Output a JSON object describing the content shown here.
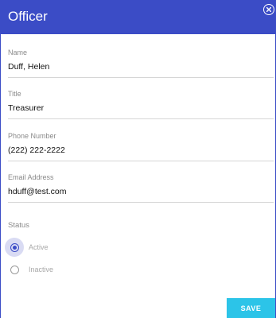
{
  "dialog": {
    "title": "Officer"
  },
  "fields": {
    "name": {
      "label": "Name",
      "value": "Duff, Helen"
    },
    "title": {
      "label": "Title",
      "value": "Treasurer"
    },
    "phone": {
      "label": "Phone Number",
      "value": "(222) 222-2222"
    },
    "email": {
      "label": "Email Address",
      "value": "hduff@test.com"
    }
  },
  "status": {
    "label": "Status",
    "options": [
      {
        "label": "Active",
        "checked": true
      },
      {
        "label": "Inactive",
        "checked": false
      }
    ]
  },
  "actions": {
    "save_label": "SAVE"
  },
  "colors": {
    "header": "#3b4cc6",
    "save_button": "#2cc4e8",
    "radio_selected": "#3b4cc6"
  },
  "icons": {
    "close": "close-circle-icon"
  }
}
